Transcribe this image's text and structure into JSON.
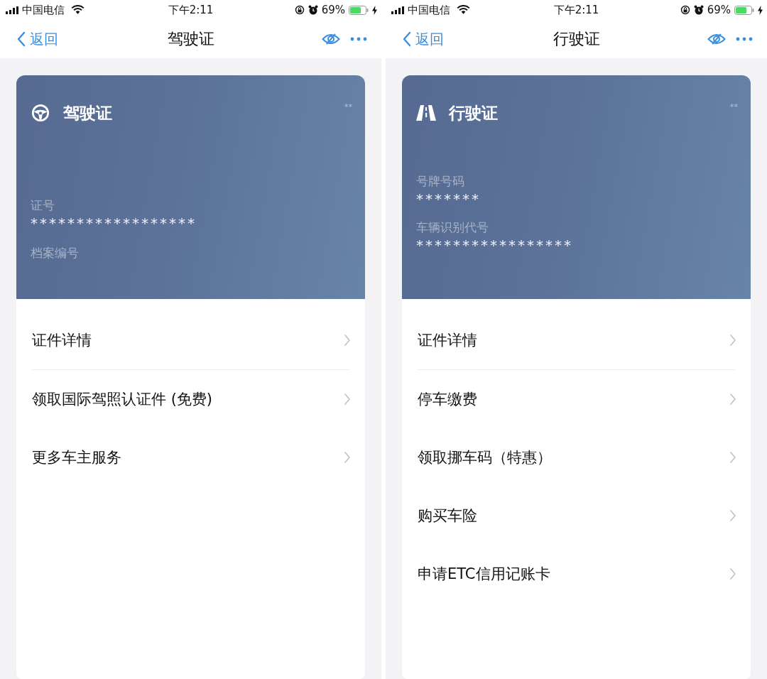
{
  "screens": [
    {
      "status_bar": {
        "carrier": "中国电信",
        "time": "下午2:11",
        "battery": "69%"
      },
      "nav": {
        "back": "返回",
        "title": "驾驶证"
      },
      "card": {
        "kind": "driver",
        "title": "驾驶证",
        "corner": "**",
        "fields": [
          {
            "label": "证号",
            "value": "******************"
          },
          {
            "label": "档案编号"
          }
        ]
      },
      "menu": [
        "证件详情",
        "领取国际驾照认证件 (免费)",
        "更多车主服务"
      ]
    },
    {
      "status_bar": {
        "carrier": "中国电信",
        "time": "下午2:11",
        "battery": "69%"
      },
      "nav": {
        "back": "返回",
        "title": "行驶证"
      },
      "card": {
        "kind": "vehicle",
        "title": "行驶证",
        "corner": "**",
        "fields": [
          {
            "label": "号牌号码",
            "value": "*******"
          },
          {
            "label": "车辆识别代号",
            "value": "*****************"
          }
        ]
      },
      "menu": [
        "证件详情",
        "停车缴费",
        "领取挪车码（特惠）",
        "购买车险",
        "申请ETC信用记账卡"
      ]
    }
  ]
}
